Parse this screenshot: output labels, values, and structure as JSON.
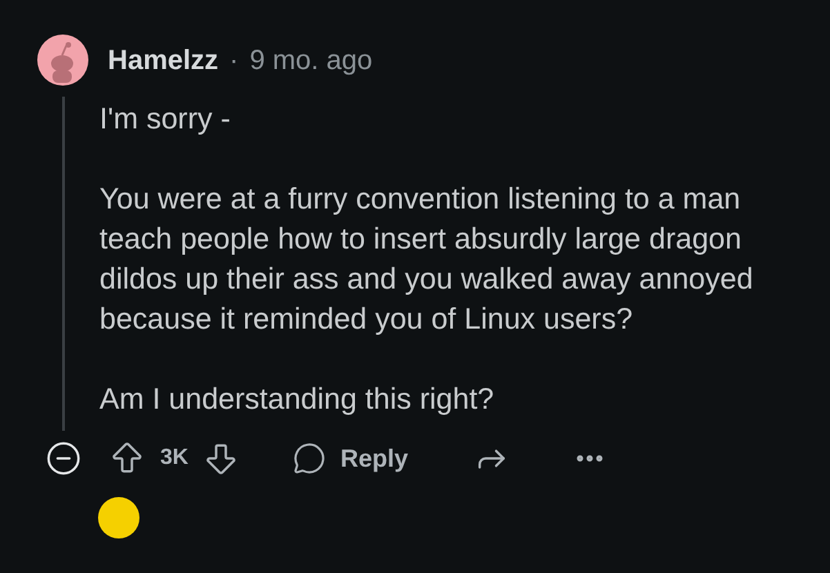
{
  "comment": {
    "author": "Hamelzz",
    "separator": "·",
    "time": "9 mo. ago",
    "paragraphs": [
      "I'm sorry -",
      "You were at a furry convention listening to a man teach people how to insert absurdly large dragon dildos up their ass and you walked away annoyed because it reminded you of Linux users?",
      "Am I understanding this right?"
    ],
    "score": "3K",
    "reply_label": "Reply",
    "expanded": true
  }
}
